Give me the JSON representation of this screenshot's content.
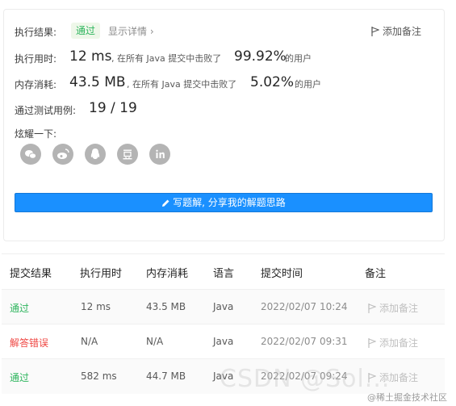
{
  "result": {
    "label": "执行结果:",
    "status": "通过",
    "detail_link": "显示详情",
    "add_note": "添加备注"
  },
  "runtime": {
    "label": "执行用时:",
    "value": "12 ms",
    "prefix": ", 在所有 Java 提交中击败了",
    "percent": "99.92%",
    "suffix": "的用户"
  },
  "memory": {
    "label": "内存消耗:",
    "value": "43.5 MB",
    "prefix": ", 在所有 Java 提交中击败了",
    "percent": "5.02%",
    "suffix": "的用户"
  },
  "tests": {
    "label": "通过测试用例:",
    "value": "19 / 19"
  },
  "share": {
    "label": "炫耀一下:",
    "icons": [
      "wechat-icon",
      "weibo-icon",
      "qq-icon",
      "douban-icon",
      "linkedin-icon"
    ]
  },
  "write_button": "写题解, 分享我的解题思路",
  "table": {
    "headers": [
      "提交结果",
      "执行用时",
      "内存消耗",
      "语言",
      "提交时间",
      "备注"
    ],
    "rows": [
      {
        "result": "通过",
        "runtime": "12 ms",
        "memory": "43.5 MB",
        "language": "Java",
        "time": "2022/02/07 10:24",
        "note": "添加备注"
      },
      {
        "result": "解答错误",
        "runtime": "N/A",
        "memory": "N/A",
        "language": "Java",
        "time": "2022/02/07 09:31",
        "note": "添加备注"
      },
      {
        "result": "通过",
        "runtime": "582 ms",
        "memory": "44.7 MB",
        "language": "Java",
        "time": "2022/02/07 09:24",
        "note": "添加备注"
      }
    ]
  },
  "watermark": "CSDN @Sol...",
  "watermark_site": "@稀土掘金技术社区",
  "colors": {
    "pass": "#2db55d",
    "error": "#ef4743",
    "primary": "#1a90ff"
  }
}
